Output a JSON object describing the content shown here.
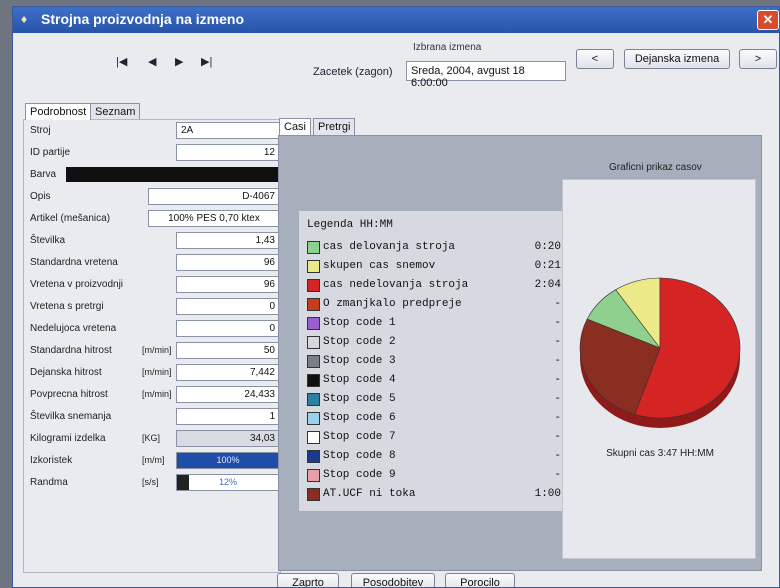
{
  "window": {
    "title": "Strojna proizvodnja na izmeno",
    "close_glyph": "✕"
  },
  "nav": {
    "first": "|◀",
    "prev": "◀",
    "next": "▶",
    "last": "▶|"
  },
  "shift": {
    "caption": "Izbrana izmena",
    "start_label": "Zacetek (zagon)",
    "start_value": "Sreda, 2004, avgust 18 6:00:00",
    "prev_btn": "<",
    "current_btn": "Dejanska izmena",
    "next_btn": ">"
  },
  "left_tabs": [
    "Podrobnost",
    "Seznam"
  ],
  "right_tabs": [
    "Casi",
    "Pretrgi"
  ],
  "fields": {
    "stroj": {
      "label": "Stroj",
      "value": "2A"
    },
    "id_partije": {
      "label": "ID partije",
      "value": "12"
    },
    "barva": {
      "label": "Barva",
      "color": "#101010"
    },
    "opis": {
      "label": "Opis",
      "value": "D-4067"
    },
    "artikel": {
      "label": "Artikel (mešanica)",
      "value": "100% PES 0,70 ktex"
    },
    "stevilka": {
      "label": "Številka",
      "value": "1,43"
    },
    "std_vretena": {
      "label": "Standardna vretena",
      "value": "96"
    },
    "vretena_proizv": {
      "label": "Vretena v proizvodnji",
      "value": "96"
    },
    "vretena_pretrgi": {
      "label": "Vretena s pretrgi",
      "value": "0"
    },
    "nedelujoca": {
      "label": "Nedelujoca vretena",
      "value": "0"
    },
    "std_hitrost": {
      "label": "Standardna hitrost",
      "unit": "[m/min]",
      "value": "50"
    },
    "dej_hitrost": {
      "label": "Dejanska hitrost",
      "unit": "[m/min]",
      "value": "7,442"
    },
    "povp_hitrost": {
      "label": "Povprecna hitrost",
      "unit": "[m/min]",
      "value": "24,433"
    },
    "st_snemanja": {
      "label": "Številka snemanja",
      "value": "1"
    },
    "kilogrami": {
      "label": "Kilogrami izdelka",
      "unit": "[KG]",
      "value": "34,03"
    },
    "izkoristek": {
      "label": "Izkoristek",
      "unit": "[m/m]",
      "text": "100%",
      "fraction": 1.0
    },
    "randma": {
      "label": "Randma",
      "unit": "[s/s]",
      "text": "12%",
      "fraction": 0.12
    }
  },
  "legend": {
    "title": "Legenda HH:MM",
    "items": [
      {
        "name": "cas delovanja stroja",
        "value": "0:20",
        "color": "#8fd08f"
      },
      {
        "name": "skupen cas snemov",
        "value": "0:21",
        "color": "#ecea88"
      },
      {
        "name": "cas nedelovanja stroja",
        "value": "2:04",
        "color": "#d42424"
      },
      {
        "name": "O zmanjkalo predpreje",
        "value": "-",
        "color": "#c83c1e"
      },
      {
        "name": "Stop code 1",
        "value": "-",
        "color": "#9b5ed0"
      },
      {
        "name": "Stop code 2",
        "value": "-",
        "color": "#d4d7df"
      },
      {
        "name": "Stop code 3",
        "value": "-",
        "color": "#7a7f86"
      },
      {
        "name": "Stop code 4",
        "value": "-",
        "color": "#101010"
      },
      {
        "name": "Stop code 5",
        "value": "-",
        "color": "#2f7fa0"
      },
      {
        "name": "Stop code 6",
        "value": "-",
        "color": "#9ad0ec"
      },
      {
        "name": "Stop code 7",
        "value": "-",
        "color": "#ffffff"
      },
      {
        "name": "Stop code 8",
        "value": "-",
        "color": "#1a3a90"
      },
      {
        "name": "Stop code 9",
        "value": "-",
        "color": "#e8a0a8"
      },
      {
        "name": "AT.UCF ni toka",
        "value": "1:00",
        "color": "#8b2e22"
      }
    ]
  },
  "chart": {
    "caption": "Graficni prikaz casov",
    "total_label": "Skupni cas 3:47  HH:MM"
  },
  "chart_data": {
    "type": "pie",
    "title": "Graficni prikaz casov",
    "labels": [
      "cas delovanja stroja",
      "skupen cas snemov",
      "cas nedelovanja stroja",
      "AT.UCF ni toka"
    ],
    "values": [
      20,
      21,
      124,
      60
    ],
    "colors": [
      "#8fd08f",
      "#ecea88",
      "#d42424",
      "#8b2e22"
    ]
  },
  "footer_buttons": {
    "close": "Zaprto",
    "refresh": "Posodobitev",
    "report": "Porocilo"
  }
}
